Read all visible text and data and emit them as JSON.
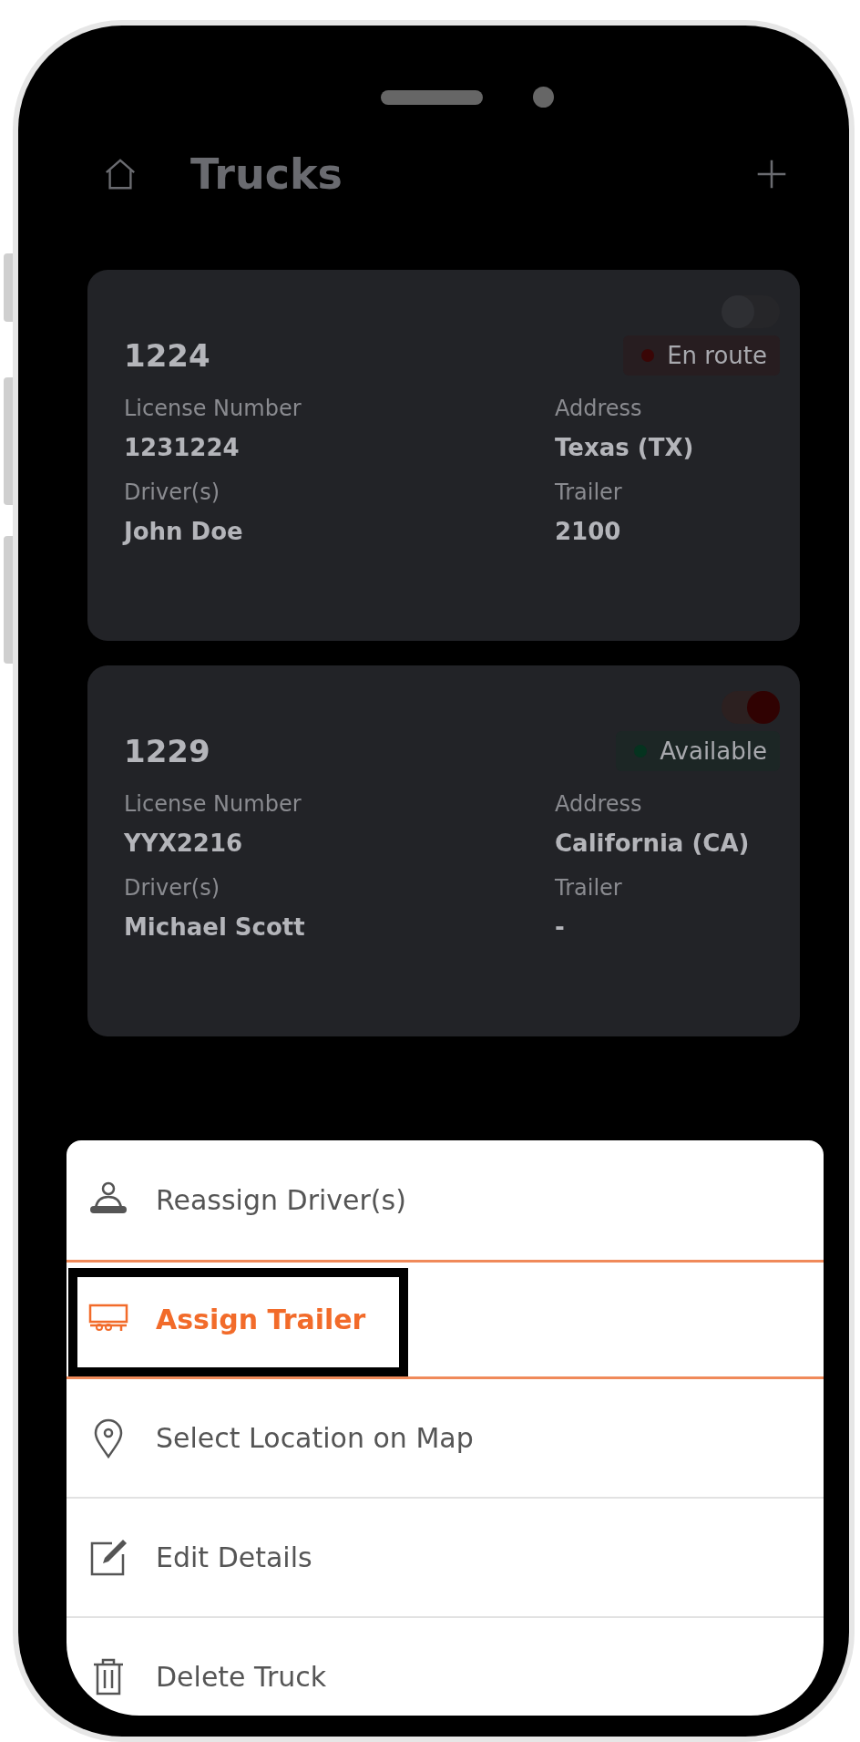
{
  "header": {
    "title": "Trucks"
  },
  "trucks": [
    {
      "number": "1224",
      "on": false,
      "status": {
        "text": "En route",
        "color": "#3a0606"
      },
      "fields": [
        {
          "label": "License Number",
          "value": "1231224"
        },
        {
          "label": "Address",
          "value": "Texas (TX)"
        },
        {
          "label": "Driver(s)",
          "value": "John Doe"
        },
        {
          "label": "Trailer",
          "value": "2100"
        }
      ]
    },
    {
      "number": "1229",
      "on": true,
      "status": {
        "text": "Available",
        "color": "#05331f"
      },
      "fields": [
        {
          "label": "License Number",
          "value": "YYX2216"
        },
        {
          "label": "Address",
          "value": "California (CA)"
        },
        {
          "label": "Driver(s)",
          "value": "Michael Scott"
        },
        {
          "label": "Trailer",
          "value": "-"
        }
      ]
    }
  ],
  "actions": [
    {
      "kind": "driver",
      "label": "Reassign Driver(s)",
      "selected": false
    },
    {
      "kind": "trailer",
      "label": "Assign Trailer",
      "selected": true
    },
    {
      "kind": "pin",
      "label": "Select Location on Map",
      "selected": false
    },
    {
      "kind": "edit",
      "label": "Edit Details",
      "selected": false
    },
    {
      "kind": "trash",
      "label": "Delete Truck",
      "selected": false
    }
  ]
}
